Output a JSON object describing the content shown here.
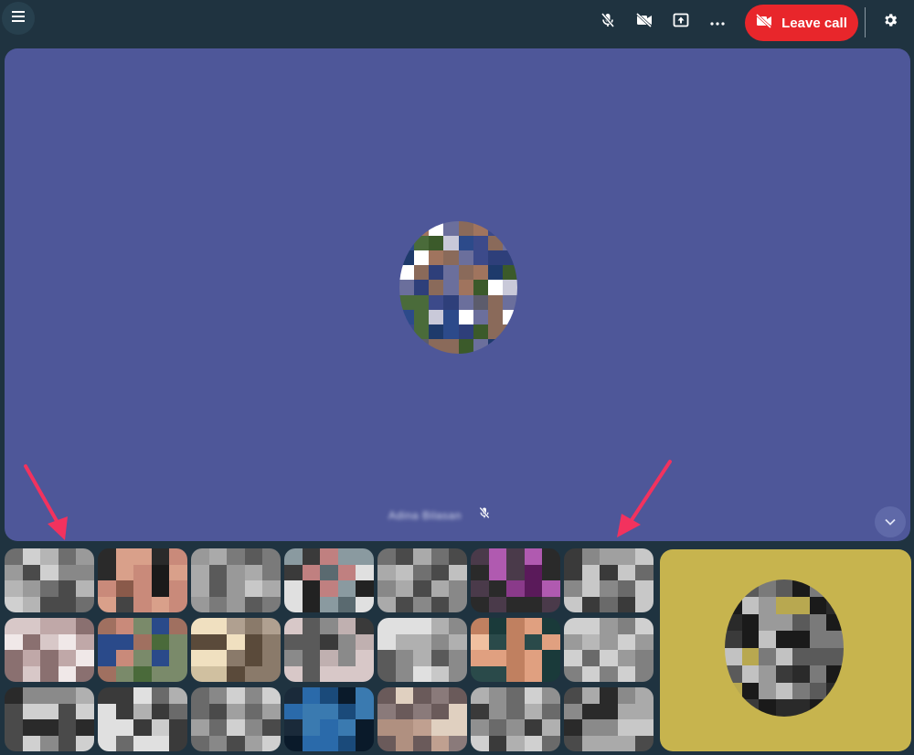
{
  "toolbar": {
    "menu_icon": "menu-icon",
    "mic_icon": "mic-off-icon",
    "camera_icon": "camera-off-icon",
    "share_icon": "present-screen-icon",
    "more_icon": "more-options-icon",
    "leave_label": "Leave call",
    "leave_icon": "camera-off-icon",
    "settings_icon": "gear-icon"
  },
  "stage": {
    "speaker_name": "Adina Bilasan",
    "speaker_mic_icon": "mic-off-icon",
    "expand_icon": "chevron-down-icon",
    "background_color": "#4e5799"
  },
  "self_view": {
    "background_color": "#c7b44e"
  },
  "colors": {
    "leave": "#e8262b",
    "arrow": "#f2325e",
    "app_background": "#1f3340"
  }
}
